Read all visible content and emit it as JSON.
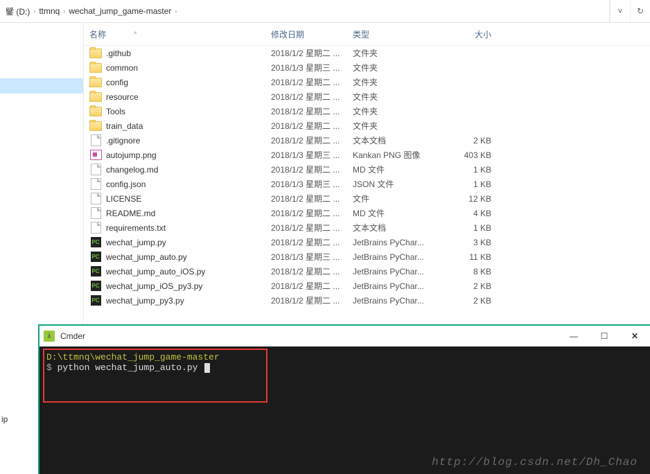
{
  "breadcrumb": {
    "drive": "鐾 (D:)",
    "p1": "ttmnq",
    "p2": "wechat_jump_game-master"
  },
  "nav": {
    "dropdown": "˅",
    "refresh": "↻"
  },
  "sidebar": {
    "selected": "",
    "space": ""
  },
  "headers": {
    "name": "名称",
    "date": "修改日期",
    "type": "类型",
    "size": "大小",
    "sort": "^"
  },
  "files": [
    {
      "icon": "folder",
      "name": ".github",
      "date": "2018/1/2 星期二 ...",
      "type": "文件夹",
      "size": ""
    },
    {
      "icon": "folder",
      "name": "common",
      "date": "2018/1/3 星期三 ...",
      "type": "文件夹",
      "size": ""
    },
    {
      "icon": "folder",
      "name": "config",
      "date": "2018/1/2 星期二 ...",
      "type": "文件夹",
      "size": ""
    },
    {
      "icon": "folder",
      "name": "resource",
      "date": "2018/1/2 星期二 ...",
      "type": "文件夹",
      "size": ""
    },
    {
      "icon": "folder",
      "name": "Tools",
      "date": "2018/1/2 星期二 ...",
      "type": "文件夹",
      "size": ""
    },
    {
      "icon": "folder",
      "name": "train_data",
      "date": "2018/1/2 星期二 ...",
      "type": "文件夹",
      "size": ""
    },
    {
      "icon": "file",
      "name": ".gitignore",
      "date": "2018/1/2 星期二 ...",
      "type": "文本文档",
      "size": "2 KB"
    },
    {
      "icon": "png",
      "name": "autojump.png",
      "date": "2018/1/3 星期三 ...",
      "type": "Kankan PNG 图像",
      "size": "403 KB"
    },
    {
      "icon": "file",
      "name": "changelog.md",
      "date": "2018/1/2 星期二 ...",
      "type": "MD 文件",
      "size": "1 KB"
    },
    {
      "icon": "file",
      "name": "config.json",
      "date": "2018/1/3 星期三 ...",
      "type": "JSON 文件",
      "size": "1 KB"
    },
    {
      "icon": "file",
      "name": "LICENSE",
      "date": "2018/1/2 星期二 ...",
      "type": "文件",
      "size": "12 KB"
    },
    {
      "icon": "file",
      "name": "README.md",
      "date": "2018/1/2 星期二 ...",
      "type": "MD 文件",
      "size": "4 KB"
    },
    {
      "icon": "file",
      "name": "requirements.txt",
      "date": "2018/1/2 星期二 ...",
      "type": "文本文档",
      "size": "1 KB"
    },
    {
      "icon": "py",
      "name": "wechat_jump.py",
      "date": "2018/1/2 星期二 ...",
      "type": "JetBrains PyChar...",
      "size": "3 KB"
    },
    {
      "icon": "py",
      "name": "wechat_jump_auto.py",
      "date": "2018/1/3 星期三 ...",
      "type": "JetBrains PyChar...",
      "size": "11 KB"
    },
    {
      "icon": "py",
      "name": "wechat_jump_auto_iOS.py",
      "date": "2018/1/2 星期二 ...",
      "type": "JetBrains PyChar...",
      "size": "8 KB"
    },
    {
      "icon": "py",
      "name": "wechat_jump_iOS_py3.py",
      "date": "2018/1/2 星期二 ...",
      "type": "JetBrains PyChar...",
      "size": "2 KB"
    },
    {
      "icon": "py",
      "name": "wechat_jump_py3.py",
      "date": "2018/1/2 星期二 ...",
      "type": "JetBrains PyChar...",
      "size": "2 KB"
    }
  ],
  "terminal": {
    "title": "Cmder",
    "min": "—",
    "max": "☐",
    "close": "✕",
    "prompt_path": "D:\\ttmnq\\wechat_jump_game-master",
    "prompt_symbol": "$",
    "command": "python wechat_jump_auto.py",
    "logo": "λ"
  },
  "watermark": "http://blog.csdn.net/Dh_Chao",
  "left_label": "ip"
}
